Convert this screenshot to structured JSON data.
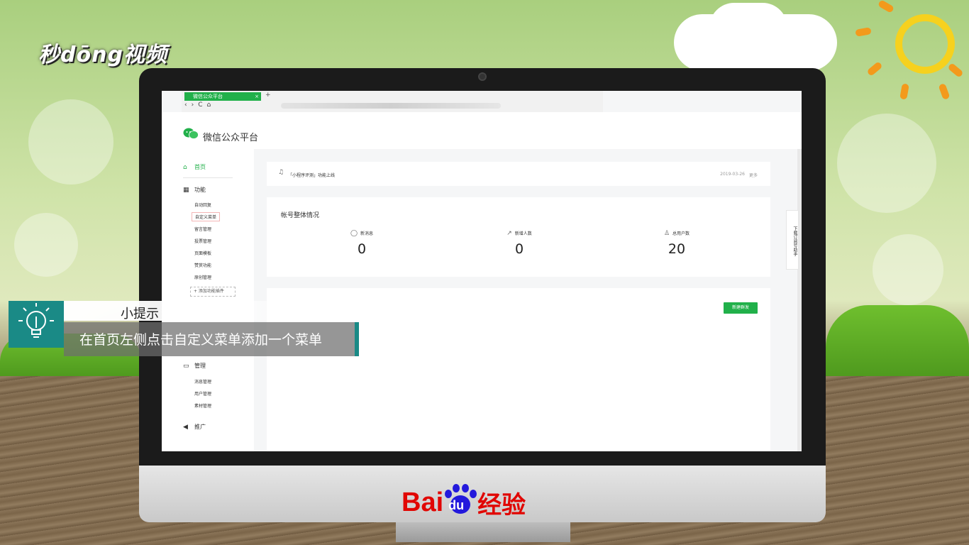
{
  "branding": {
    "video_logo": "秒dōng视频",
    "baidu_word": "Bai",
    "baidu_du": "du",
    "baidu_suffix": "经验"
  },
  "browser": {
    "tab_title": "微信公众平台",
    "tab_close": "×",
    "tab_new": "+",
    "nav_back": "‹",
    "nav_forward": "›",
    "nav_reload": "C",
    "nav_home": "⌂"
  },
  "header": {
    "title": "微信公众平台"
  },
  "sidebar": {
    "home": "首页",
    "features": "功能",
    "feature_items": [
      "自动回复",
      "自定义菜单",
      "留言管理",
      "投票管理",
      "页面模板",
      "赞赏功能",
      "原创管理"
    ],
    "add_plugin": "+ 添加功能插件",
    "management": "管理",
    "management_items": [
      "消息管理",
      "用户管理",
      "素材管理"
    ],
    "promotion": "推广"
  },
  "notice": {
    "text": "「小程序评测」功能上线",
    "date": "2019-03-26",
    "more": "更多"
  },
  "stats": {
    "title": "帐号整体情况",
    "items": [
      {
        "label": "新消息",
        "value": "0"
      },
      {
        "label": "新增人数",
        "value": "0"
      },
      {
        "label": "总用户数",
        "value": "20"
      }
    ]
  },
  "panel": {
    "new_button": "新建群发"
  },
  "helper": {
    "text": "下载订阅号助手"
  },
  "tip": {
    "title": "小提示",
    "text": "在首页左侧点击自定义菜单添加一个菜单"
  },
  "colors": {
    "wechat_green": "#21b04a",
    "tip_teal": "#1a8a86",
    "baidu_red": "#e10602",
    "baidu_blue": "#2319dc"
  }
}
